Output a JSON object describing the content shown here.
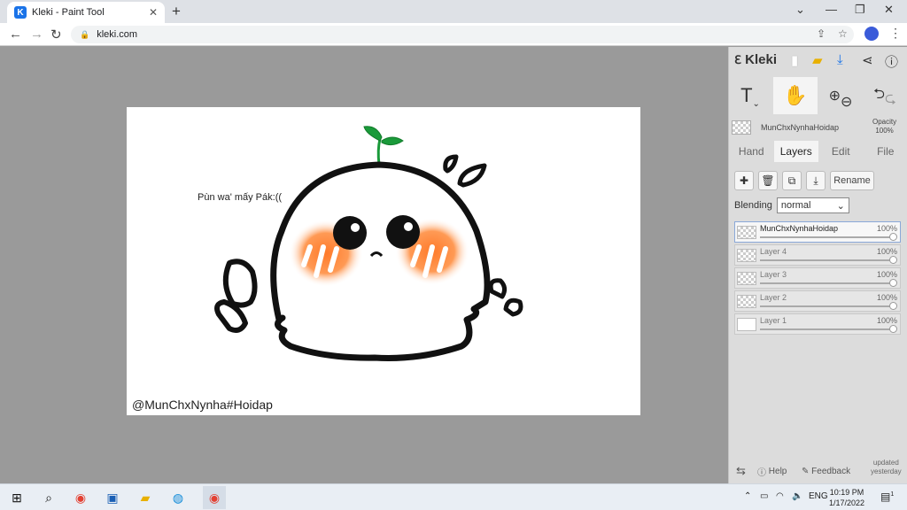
{
  "browser": {
    "tab_title": "Kleki - Paint Tool",
    "tab_favicon": "K",
    "url": "kleki.com"
  },
  "canvas": {
    "text": "Pùn wa' mấy Pák:((",
    "signature": "@MunChxNynha#Hoidap"
  },
  "panel": {
    "logo": "Kleki",
    "layer_header": {
      "name": "MunChxNynhaHoidap",
      "opacity_label": "Opacity",
      "opacity_value": "100%"
    },
    "tabs": [
      "Hand",
      "Layers",
      "Edit",
      "File"
    ],
    "active_tab": "Layers",
    "rename_label": "Rename",
    "blending_label": "Blending",
    "blending_value": "normal",
    "layers": [
      {
        "name": "MunChxNynhaHoidap",
        "opacity": "100%"
      },
      {
        "name": "Layer 4",
        "opacity": "100%"
      },
      {
        "name": "Layer 3",
        "opacity": "100%"
      },
      {
        "name": "Layer 2",
        "opacity": "100%"
      },
      {
        "name": "Layer 1",
        "opacity": "100%"
      }
    ],
    "help_label": "Help",
    "feedback_label": "Feedback",
    "updated_line1": "updated",
    "updated_line2": "yesterday"
  },
  "taskbar": {
    "language": "ENG",
    "time": "10:19 PM",
    "date": "1/17/2022",
    "notification_count": "1"
  },
  "colors": {
    "accent_blue": "#1a73e8",
    "panel_bg": "#dcdcdc",
    "blush_orange": "#ff8a3d",
    "sprout_green": "#1a9a3a"
  }
}
